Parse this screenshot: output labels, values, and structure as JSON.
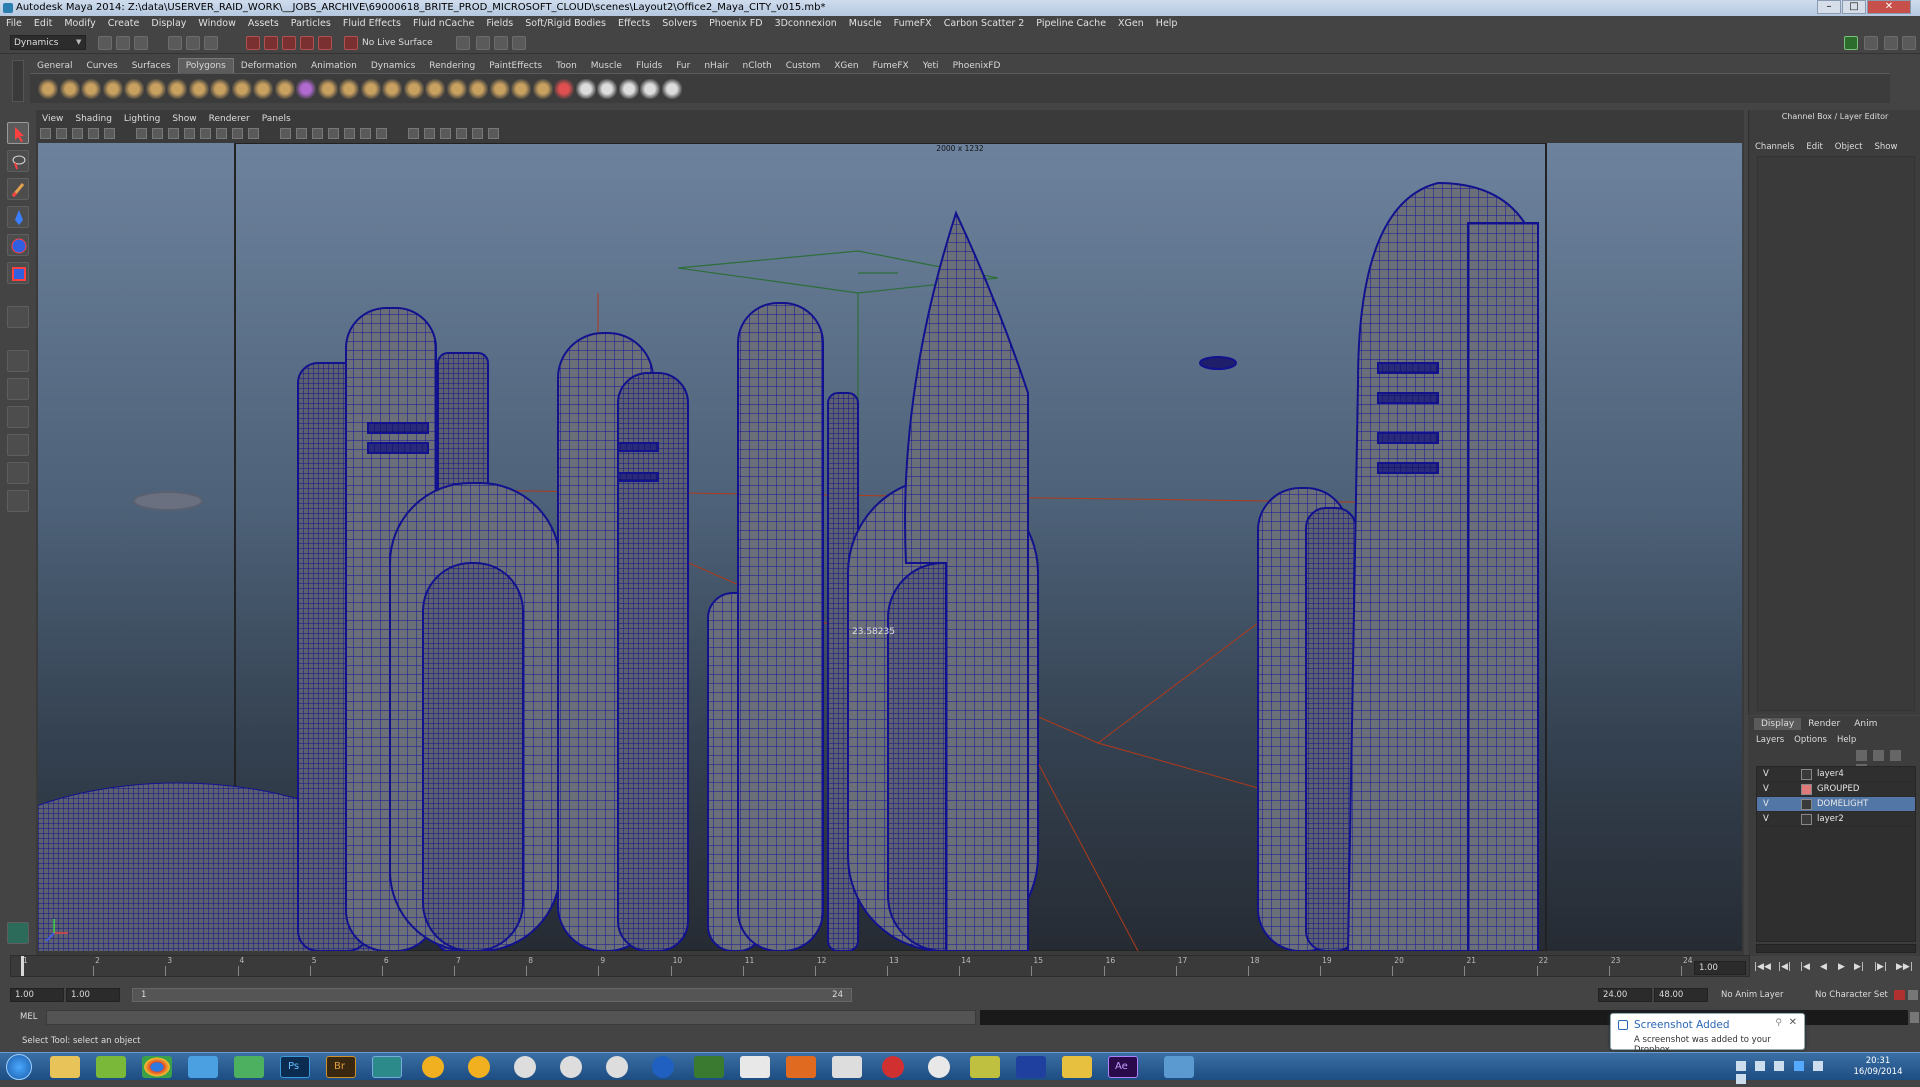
{
  "window": {
    "title": "Autodesk Maya 2014: Z:\\data\\USERVER_RAID_WORK\\__JOBS_ARCHIVE\\69000618_BRITE_PROD_MICROSOFT_CLOUD\\scenes\\Layout2\\Office2_Maya_CITY_v015.mb*",
    "minimize": "–",
    "maximize": "□",
    "close": "✕"
  },
  "menubar": [
    "File",
    "Edit",
    "Modify",
    "Create",
    "Display",
    "Window",
    "Assets",
    "Particles",
    "Fluid Effects",
    "Fluid nCache",
    "Fields",
    "Soft/Rigid Bodies",
    "Effects",
    "Solvers",
    "Phoenix FD",
    "3Dconnexion",
    "Muscle",
    "FumeFX",
    "Carbon Scatter 2",
    "Pipeline Cache",
    "XGen",
    "Help"
  ],
  "statusline": {
    "menu_set": "Dynamics",
    "live_surface": "No Live Surface"
  },
  "shelf_tabs": [
    "General",
    "Curves",
    "Surfaces",
    "Polygons",
    "Deformation",
    "Animation",
    "Dynamics",
    "Rendering",
    "PaintEffects",
    "Toon",
    "Muscle",
    "Fluids",
    "Fur",
    "nHair",
    "nCloth",
    "Custom",
    "XGen",
    "FumeFX",
    "Yeti",
    "PhoenixFD"
  ],
  "active_shelf": "Polygons",
  "panel_menu": [
    "View",
    "Shading",
    "Lighting",
    "Show",
    "Renderer",
    "Panels"
  ],
  "viewport": {
    "resolution_gate": "2000 x 1232",
    "camera_readout": "23.58235"
  },
  "channel_box": {
    "title": "Channel Box / Layer Editor",
    "menu": [
      "Channels",
      "Edit",
      "Object",
      "Show"
    ]
  },
  "layer_editor": {
    "tabs": [
      "Display",
      "Render",
      "Anim"
    ],
    "menu": [
      "Layers",
      "Options",
      "Help"
    ],
    "layers": [
      {
        "vis": "V",
        "name": "layer4",
        "color": "#3a3a3a",
        "selected": false
      },
      {
        "vis": "V",
        "name": "GROUPED",
        "color": "#e07a7a",
        "selected": false
      },
      {
        "vis": "V",
        "name": "DOMELIGHT",
        "color": "#3a3a3a",
        "selected": true
      },
      {
        "vis": "V",
        "name": "layer2",
        "color": "#3a3a3a",
        "selected": false
      }
    ]
  },
  "timeslider": {
    "ticks": [
      "1",
      "2",
      "3",
      "4",
      "5",
      "6",
      "7",
      "8",
      "9",
      "10",
      "11",
      "12",
      "13",
      "14",
      "15",
      "16",
      "17",
      "18",
      "19",
      "20",
      "21",
      "22",
      "23",
      "24"
    ],
    "current_frame": "1.00"
  },
  "range": {
    "start": "1.00",
    "start_inner": "1.00",
    "slider_start": "1",
    "slider_end": "24",
    "end_inner": "24.00",
    "end": "48.00",
    "anim_layer": "No Anim Layer",
    "char_set": "No Character Set"
  },
  "cmdline": {
    "label": "MEL"
  },
  "helpline": "Select Tool: select an object",
  "notification": {
    "title": "Screenshot Added",
    "message": "A screenshot was added to your Dropbox."
  },
  "taskbar": {
    "time": "20:31",
    "date": "16/09/2014"
  },
  "colors": {
    "wireframe": "#12129a",
    "accent_selected": "#5277a6",
    "title_bar": "#bfd0e4"
  }
}
